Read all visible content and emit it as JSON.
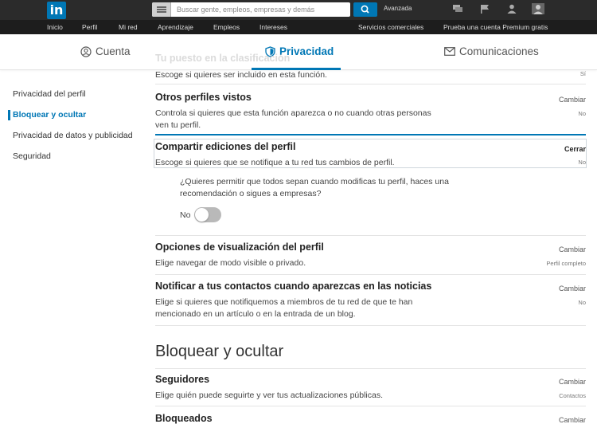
{
  "topbar": {
    "logo_text": "in",
    "search_placeholder": "Buscar gente, empleos, empresas y demás",
    "advanced_label": "Avanzada",
    "icons": [
      "menu-icon",
      "search-icon",
      "messages-icon",
      "flag-icon",
      "people-icon",
      "avatar-icon"
    ]
  },
  "nav": {
    "items": [
      "Inicio",
      "Perfil",
      "Mi red",
      "Aprendizaje",
      "Empleos",
      "Intereses"
    ],
    "business": "Servicios comerciales",
    "premium": "Prueba una cuenta Premium gratis"
  },
  "tabs": {
    "account": "Cuenta",
    "privacy": "Privacidad",
    "communications": "Comunicaciones"
  },
  "sidebar": {
    "items": [
      "Privacidad del perfil",
      "Bloquear y ocultar",
      "Privacidad de datos y publicidad",
      "Seguridad"
    ],
    "active": "Bloquear y ocultar"
  },
  "settings": {
    "faded_title": "Tu puesto en la clasificación",
    "faded_desc": "Escoge si quieres ser incluido en esta función.",
    "faded_value": "Sí",
    "other_profiles": {
      "title": "Otros perfiles vistos",
      "desc": "Controla si quieres que esta función aparezca o no cuando otras personas ven tu perfil.",
      "action": "Cambiar",
      "value": "No"
    },
    "share_edits": {
      "title": "Compartir ediciones del perfil",
      "desc": "Escoge si quieres que se notifique a tu red tus cambios de perfil.",
      "action": "Cerrar",
      "value": "No",
      "question": "¿Quieres permitir que todos sepan cuando modificas tu perfil, haces una recomendación o sigues a empresas?",
      "toggle_label": "No",
      "toggle_on": false
    },
    "view_options": {
      "title": "Opciones de visualización del perfil",
      "desc": "Elige navegar de modo visible o privado.",
      "action": "Cambiar",
      "value": "Perfil completo"
    },
    "notify_contacts": {
      "title": "Notificar a tus contactos cuando aparezcas en las noticias",
      "desc": "Elige si quieres que notifiquemos a miembros de tu red de que te han mencionado en un artículo o en la entrada de un blog.",
      "action": "Cambiar",
      "value": "No"
    }
  },
  "block_section": {
    "heading": "Bloquear y ocultar",
    "followers": {
      "title": "Seguidores",
      "desc": "Elige quién puede seguirte y ver tus actualizaciones públicas.",
      "action": "Cambiar",
      "value": "Contactos"
    },
    "blocked": {
      "title": "Bloqueados",
      "action": "Cambiar"
    }
  },
  "colors": {
    "brand": "#0077b5",
    "topbar": "#2b2b2b",
    "navbar": "#1d1d1d"
  }
}
